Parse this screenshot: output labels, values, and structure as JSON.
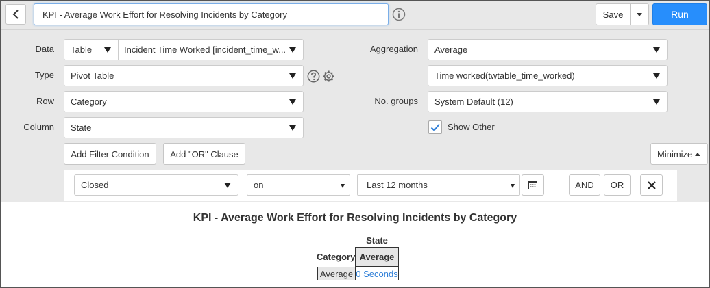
{
  "header": {
    "title_value": "KPI - Average Work Effort for Resolving Incidents by Category",
    "save_label": "Save",
    "run_label": "Run"
  },
  "config": {
    "data_label": "Data",
    "data_source": "Table",
    "data_table": "Incident Time Worked [incident_time_w...",
    "type_label": "Type",
    "type_value": "Pivot Table",
    "row_label": "Row",
    "row_value": "Category",
    "column_label": "Column",
    "column_value": "State",
    "aggregation_label": "Aggregation",
    "aggregation_value": "Average",
    "aggregation_field": "Time worked(twtable_time_worked)",
    "groups_label": "No. groups",
    "groups_value": "System Default (12)",
    "show_other_label": "Show Other",
    "show_other_checked": true,
    "add_filter_label": "Add Filter Condition",
    "add_or_label": "Add \"OR\" Clause",
    "minimize_label": "Minimize"
  },
  "filter": {
    "field": "Closed",
    "operator": "on",
    "value": "Last 12 months",
    "and_label": "AND",
    "or_label": "OR"
  },
  "report": {
    "title": "KPI - Average Work Effort for Resolving Incidents by Category",
    "column_group_header": "State",
    "row_header": "Category",
    "measure_header": "Average",
    "row_label": "Average",
    "row_value": "0 Seconds"
  },
  "colors": {
    "accent": "#278efc",
    "link": "#2f7fd8",
    "panel_bg": "#e8e8e8"
  }
}
